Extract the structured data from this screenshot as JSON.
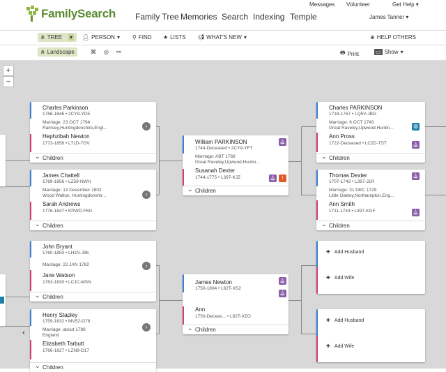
{
  "header": {
    "logo": "FamilySearch",
    "nav": [
      "Family Tree",
      "Memories",
      "Search",
      "Indexing",
      "Temple"
    ],
    "util": [
      "Messages",
      "Volunteer",
      "Get Help ▾"
    ],
    "user": "James Tanner ▾"
  },
  "toolbar": {
    "tree": "TREE",
    "person": "PERSON",
    "find": "FIND",
    "lists": "LISTS",
    "whats_new": "WHAT'S NEW",
    "help": "HELP OTHERS"
  },
  "subtoolbar": {
    "landscape": "Landscape",
    "print": "Print",
    "show": "Show"
  },
  "zoom": {
    "in": "+",
    "out": "−"
  },
  "children_label": "Children",
  "couples": [
    {
      "husband": "Charles Parkinson",
      "h_life": "1766-1846 • 2CY9-YD5",
      "marriage": "Marriage: 23 OCT 1794",
      "place": "Ramsey,Huntingdonshire,Engl...",
      "wife": "Hephzibah Newton",
      "w_life": "1773-1856 • L71D-7GV"
    },
    {
      "husband": "James Chattell",
      "h_life": "1769-1856 • LZ59-NWH",
      "marriage": "Marriage: 13 December 1802",
      "place": "Wood Walton, Huntingdonshir...",
      "wife": "Sarah Andrews",
      "w_life": "1776-1847 • KPWD-FM1"
    },
    {
      "husband": "John Bryant",
      "h_life": "1760-1850 • LH1N-J96",
      "marriage": "Marriage: 22 JAN 1782",
      "place": "",
      "wife": "Jane Watson",
      "w_life": "1763-1830 • LCJC-MSN"
    },
    {
      "husband": "Henry Stapley",
      "h_life": "1759-1832 • MV52-G78",
      "marriage": "Marriage: about 1788",
      "place": "England",
      "wife": "Elizabeth Tarbutt",
      "w_life": "1766-1827 • LZN9-D17"
    },
    {
      "husband": "William PARKINSON",
      "h_life": "1744-Deceased • 2CY9-YFT",
      "marriage": "Marriage: ABT 1768",
      "place": "Great Raveley,Upwood,Huntin...",
      "wife": "Susanah Dexter",
      "w_life": "1744-1775 • L397-KJZ"
    },
    {
      "husband": "James Newton",
      "h_life": "1750-1804 • L62T-XS2",
      "marriage": "",
      "place": "",
      "wife": "Ann",
      "w_life": "1750-Deceas...   • L62T-XZG"
    },
    {
      "husband": "Charles PARKINSON",
      "h_life": "1718-1767 • LQ5V-JBG",
      "marriage": "Marriage: 6 OCT 1743",
      "place": "Great Raveley,Upwood,Huntin...",
      "wife": "Ann Pross",
      "w_life": "1722-Deceased • LC2D-TST"
    },
    {
      "husband": "Thomas Dexter",
      "h_life": "1707-1743 • L397-J1R",
      "marriage": "Marriage: 31 DEC 1729",
      "place": "Little Oakley,Northampton,Eng...",
      "wife": "Ann Smith",
      "w_life": "1711-1743 • L397-KGF"
    }
  ],
  "add": {
    "husband": "Add Husband",
    "wife": "Add Wife"
  },
  "colors": {
    "male": "#3b7fd4",
    "female": "#d23c78",
    "brand": "#8cb83f",
    "temple": "#8a5ea8",
    "alert": "#e05b2a",
    "chart": "#1f7fa8"
  }
}
